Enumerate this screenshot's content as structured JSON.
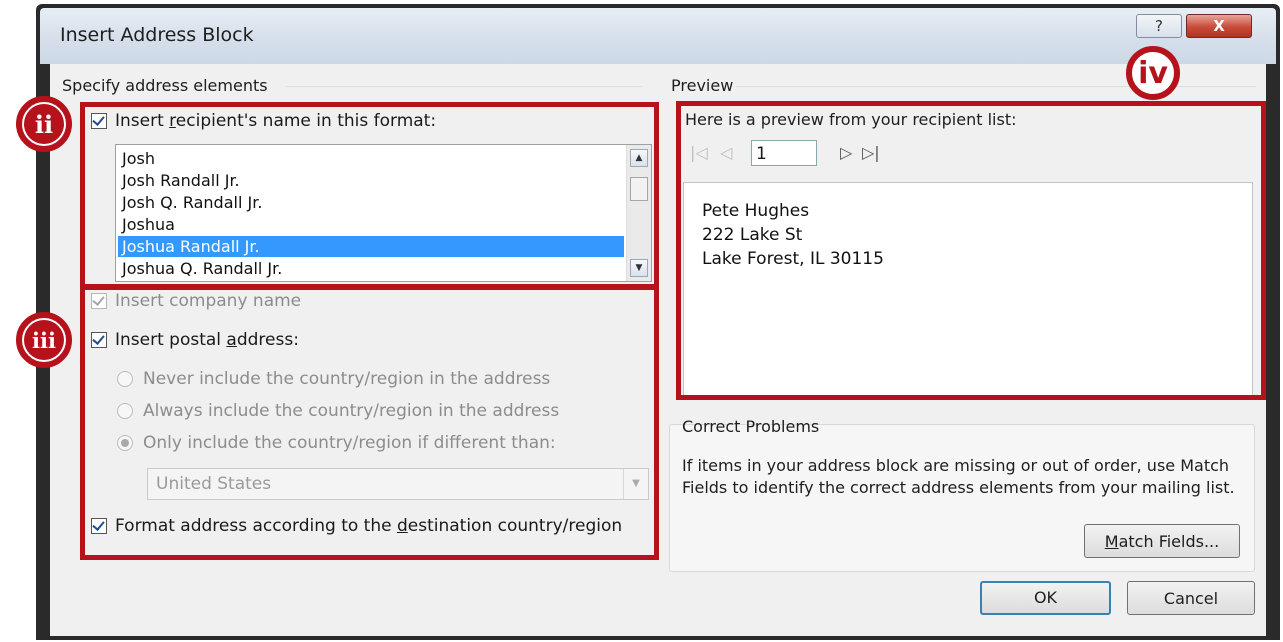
{
  "window": {
    "title": "Insert Address Block",
    "help_glyph": "?",
    "close_glyph": "X"
  },
  "left": {
    "group_title": "Specify address elements",
    "name_check": {
      "label_pre": "Insert ",
      "label_u": "r",
      "label_post": "ecipient's name in this format:",
      "checked": true
    },
    "name_formats": [
      "Josh",
      "Josh Randall Jr.",
      "Josh Q. Randall Jr.",
      "Joshua",
      "Joshua Randall Jr.",
      "Joshua Q. Randall Jr."
    ],
    "selected_format": "Joshua Randall Jr.",
    "company_check": {
      "label": "Insert company name",
      "checked": true,
      "disabled": true
    },
    "postal_check": {
      "label_pre": "Insert postal ",
      "label_u": "a",
      "label_post": "ddress:",
      "checked": true
    },
    "radios": [
      {
        "label": "Never include the country/region in the address",
        "selected": false
      },
      {
        "label": "Always include the country/region in the address",
        "selected": false
      },
      {
        "label": "Only include the country/region if different than:",
        "selected": true
      }
    ],
    "country_value": "United States",
    "format_check": {
      "label_pre": "Format address according to the ",
      "label_u": "d",
      "label_post": "estination country/region",
      "checked": true
    }
  },
  "right": {
    "group_title": "Preview",
    "preview_caption": "Here is a preview from your recipient list:",
    "record_number": "1",
    "nav_icons": [
      "first-record-icon",
      "previous-record-icon",
      "next-record-icon",
      "last-record-icon"
    ],
    "preview_lines": [
      "Pete Hughes",
      "222 Lake St",
      "Lake Forest, IL 30115"
    ],
    "correct_problems": {
      "title": "Correct Problems",
      "text": "If items in your address block are missing or out of order, use Match Fields to identify the correct address elements from your mailing list.",
      "match_pre": "",
      "match_u": "M",
      "match_post": "atch Fields..."
    }
  },
  "buttons": {
    "ok": "OK",
    "cancel": "Cancel"
  },
  "annotations": {
    "badge_ii": "ii",
    "badge_iii": "iii",
    "badge_iv": "iv",
    "color": "#b5121b"
  }
}
